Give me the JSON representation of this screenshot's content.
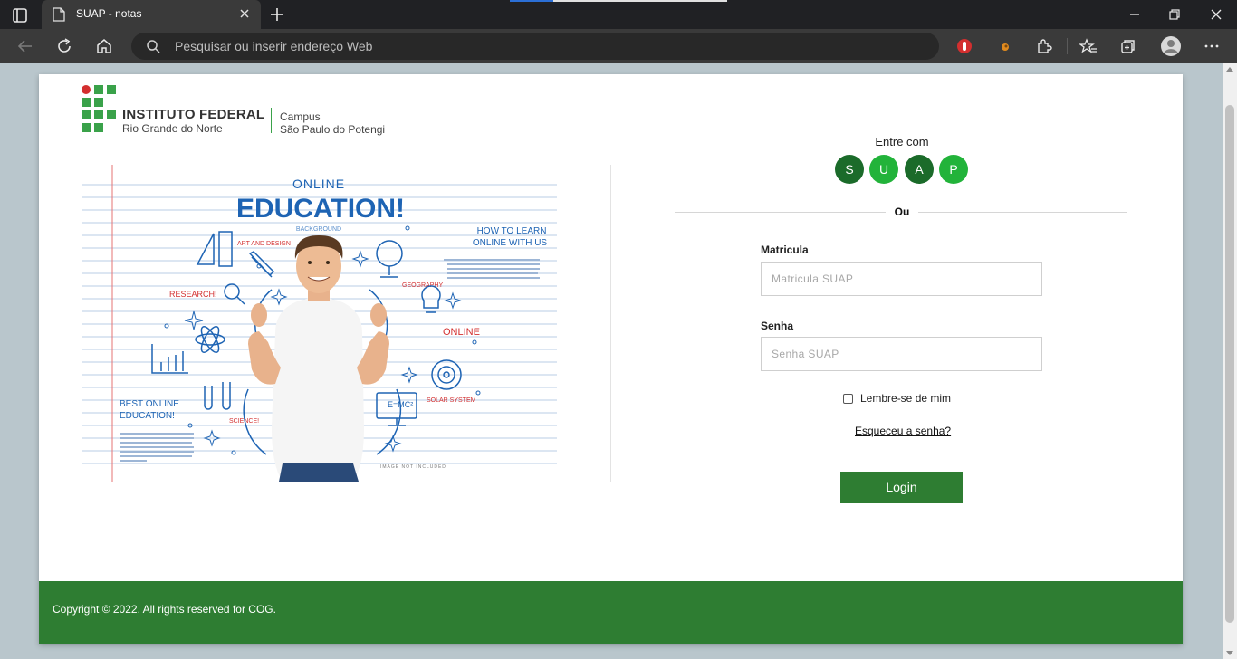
{
  "browser": {
    "tab_title": "SUAP - notas",
    "address_placeholder": "Pesquisar ou inserir endereço Web",
    "colors": {
      "tabbar": "#202124",
      "toolbar": "#3a3a3a",
      "active_tab": "#3a3a3a"
    },
    "icons": [
      "tab-actions-icon",
      "favicon-icon",
      "close-tab-icon",
      "new-tab-icon",
      "minimize-icon",
      "maximize-icon",
      "close-window-icon",
      "back-icon",
      "refresh-icon",
      "home-icon",
      "search-icon",
      "extension-red-icon",
      "extension-orange-icon",
      "extensions-icon",
      "favorites-icon",
      "collections-icon",
      "profile-icon",
      "more-icon"
    ]
  },
  "header": {
    "institution_name": "INSTITUTO FEDERAL",
    "institution_state": "Rio Grande do Norte",
    "campus_label": "Campus",
    "campus_name": "São Paulo do Potengi"
  },
  "illustration": {
    "online": "ONLINE",
    "education": "EDUCATION!",
    "background": "BACKGROUND",
    "how_to_learn": "HOW TO LEARN",
    "online_with_us": "ONLINE WITH US",
    "art_and_design": "ART AND DESIGN",
    "research": "RESEARCH!",
    "geography": "GEOGRAPHY",
    "online_word": "ONLINE",
    "best_online": "BEST ONLINE",
    "education_word": "EDUCATION!",
    "science": "SCIENCE!",
    "solar_system": "SOLAR SYSTEM",
    "formula": "E=MC²",
    "image_not_included": "IMAGE NOT INCLUDED"
  },
  "login": {
    "entre_com": "Entre com",
    "suap_letters": [
      "S",
      "U",
      "A",
      "P"
    ],
    "suap_colors": [
      "#1b6b2a",
      "#22b33a",
      "#1b6b2a",
      "#22b33a"
    ],
    "ou": "Ou",
    "matricula_label": "Matricula",
    "matricula_placeholder": "Matricula SUAP",
    "senha_label": "Senha",
    "senha_placeholder": "Senha SUAP",
    "remember_label": "Lembre-se de mim",
    "forgot_link": "Esqueceu a senha?",
    "login_button": "Login",
    "accent_color": "#2e7d32"
  },
  "footer": {
    "copyright": "Copyright © 2022. All rights reserved for COG."
  }
}
